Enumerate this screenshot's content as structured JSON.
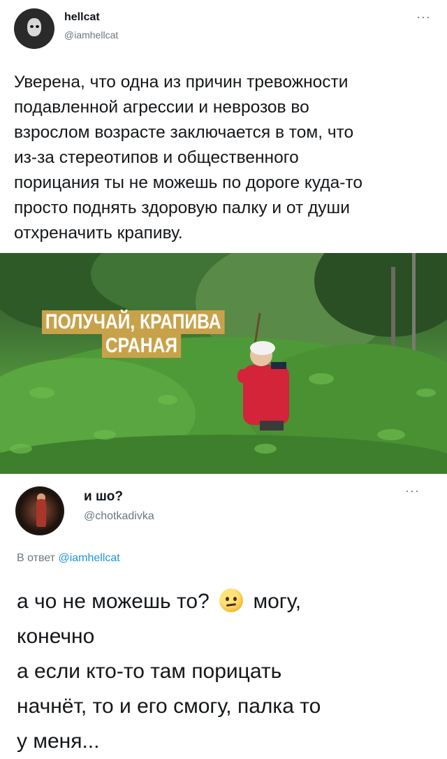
{
  "tweet": {
    "author_name": "hellcat",
    "author_handle": "@iamhellcat",
    "more_glyph": "···",
    "text_lines": [
      "Уверена, что одна из причин тревожности",
      "подавленной агрессии и неврозов во",
      "взрослом возрасте заключается в том, что",
      "из-за стереотипов и общественного",
      "порицания ты не можешь по дороге куда-то",
      "просто поднять здоровую палку и от души",
      "отхреначить крапиву."
    ]
  },
  "meme": {
    "caption_line1": "ПОЛУЧАЙ, КРАПИВА",
    "caption_line2": "СРАНАЯ"
  },
  "reply": {
    "author_name": "и шо?",
    "author_handle": "@chotkadivka",
    "more_glyph": "···",
    "reply_prefix": "В ответ",
    "reply_mention": "@iamhellcat",
    "text_line1_before": "а чо не можешь то?",
    "emoji_name": "face-with-rolling-eyes-icon",
    "text_line1_after": "могу,",
    "text_lines": [
      "конечно",
      "а если кто-то там порицать",
      "начнёт, то и его смогу, палка то",
      "у меня..."
    ]
  }
}
